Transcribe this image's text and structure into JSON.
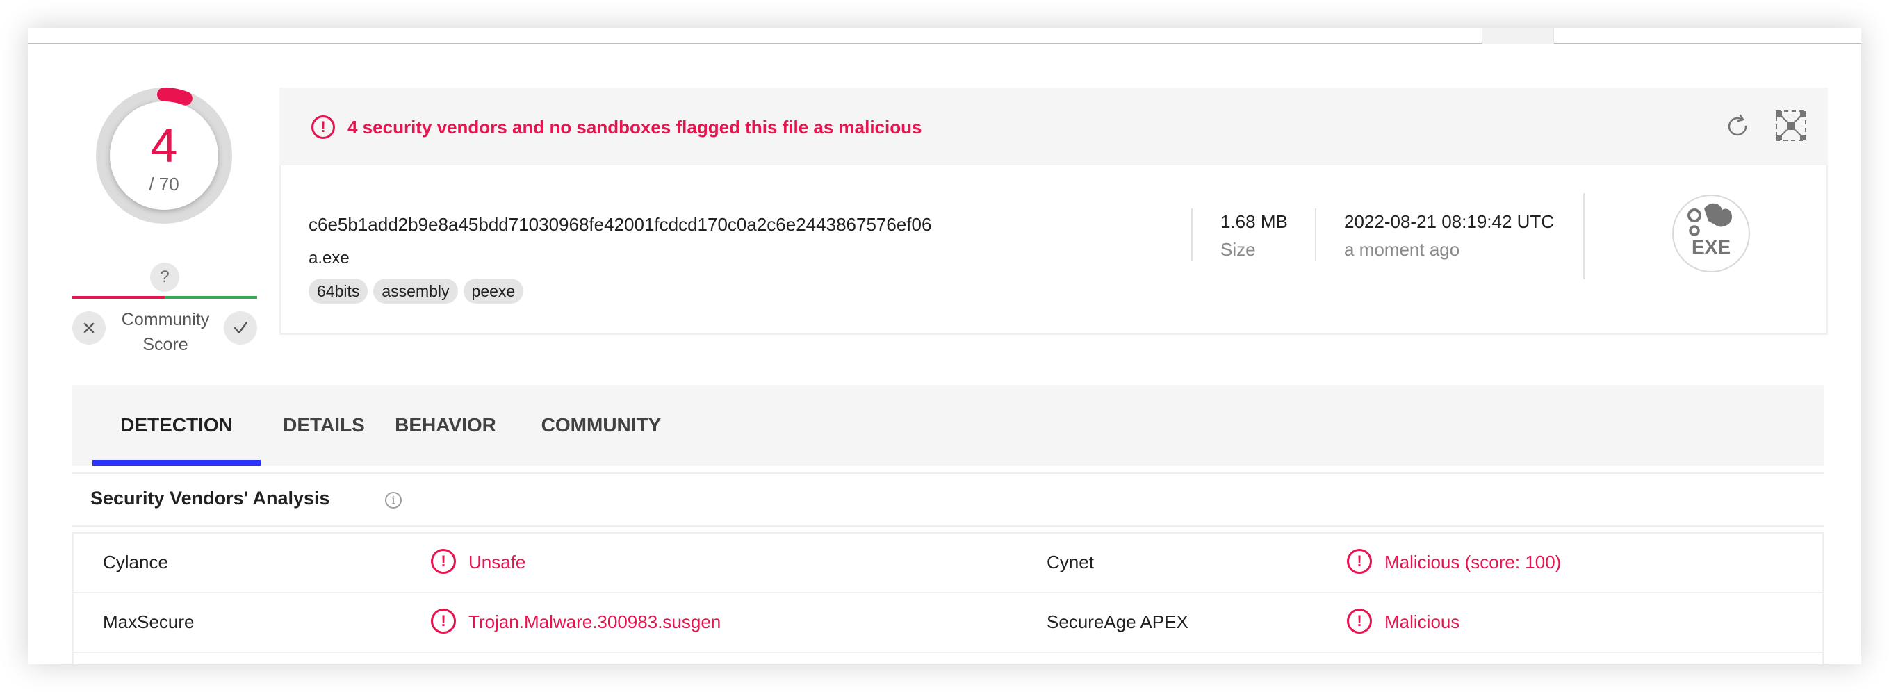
{
  "colors": {
    "malicious": "#e8134f",
    "tab_accent": "#2b33ff",
    "positive": "#34a853"
  },
  "score": {
    "detections": "4",
    "total": "/ 70",
    "ratio": 0.057
  },
  "community": {
    "unknown_symbol": "?",
    "label_line1": "Community",
    "label_line2": "Score",
    "downvote_icon": "x-icon",
    "upvote_icon": "check-icon"
  },
  "banner": {
    "alert_symbol": "!",
    "message": "4 security vendors and no sandboxes flagged this file as malicious",
    "reanalyze_icon": "reload-icon",
    "graph_icon": "graph-icon"
  },
  "file": {
    "hash": "c6e5b1add2b9e8a45bdd71030968fe42001fcdcd170c0a2c6e2443867576ef06",
    "name": "a.exe",
    "tags": [
      "64bits",
      "assembly",
      "peexe"
    ],
    "size_value": "1.68 MB",
    "size_label": "Size",
    "date_value": "2022-08-21 08:19:42 UTC",
    "date_relative": "a moment ago",
    "type_label": "EXE",
    "type_icon": "exe-file-icon"
  },
  "tabs": [
    {
      "label": "DETECTION",
      "active": true
    },
    {
      "label": "DETAILS",
      "active": false
    },
    {
      "label": "BEHAVIOR",
      "active": false
    },
    {
      "label": "COMMUNITY",
      "active": false
    }
  ],
  "section": {
    "title": "Security Vendors' Analysis",
    "info_symbol": "i"
  },
  "vendors": [
    {
      "left_name": "Cylance",
      "left_result": "Unsafe",
      "right_name": "Cynet",
      "right_result": "Malicious (score: 100)"
    },
    {
      "left_name": "MaxSecure",
      "left_result": "Trojan.Malware.300983.susgen",
      "right_name": "SecureAge APEX",
      "right_result": "Malicious"
    }
  ],
  "vendor_alert_symbol": "!"
}
